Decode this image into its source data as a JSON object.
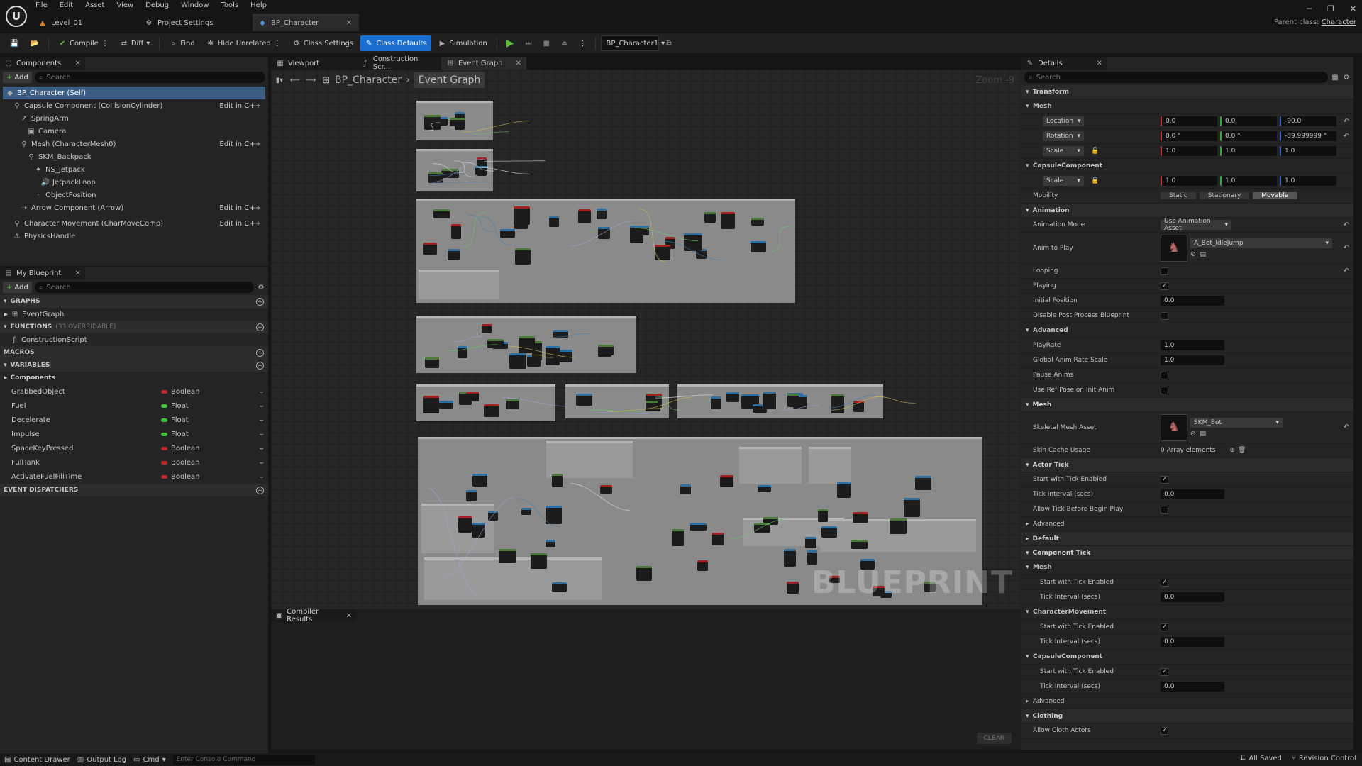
{
  "window": {
    "menu": [
      "File",
      "Edit",
      "Asset",
      "View",
      "Debug",
      "Window",
      "Tools",
      "Help"
    ],
    "tabs": [
      {
        "label": "Level_01",
        "icon": "level-icon"
      },
      {
        "label": "Project Settings",
        "icon": "gear-icon"
      },
      {
        "label": "BP_Character",
        "icon": "blueprint-icon",
        "active": true
      }
    ],
    "parent_class_label": "Parent class:",
    "parent_class_value": "Character"
  },
  "toolbar": {
    "compile": "Compile",
    "diff": "Diff",
    "find": "Find",
    "hide_unrelated": "Hide Unrelated",
    "class_settings": "Class Settings",
    "class_defaults": "Class Defaults",
    "simulation": "Simulation",
    "debug_object": "BP_Character1"
  },
  "components": {
    "title": "Components",
    "add": "Add",
    "search_placeholder": "Search",
    "tree": [
      {
        "label": "BP_Character (Self)",
        "indent": 0,
        "selected": true
      },
      {
        "label": "Capsule Component (CollisionCylinder)",
        "indent": 1,
        "edit": "Edit in C++"
      },
      {
        "label": "SpringArm",
        "indent": 2
      },
      {
        "label": "Camera",
        "indent": 3
      },
      {
        "label": "Mesh (CharacterMesh0)",
        "indent": 2,
        "edit": "Edit in C++"
      },
      {
        "label": "SKM_Backpack",
        "indent": 3
      },
      {
        "label": "NS_Jetpack",
        "indent": 4
      },
      {
        "label": "JetpackLoop",
        "indent": 5
      },
      {
        "label": "ObjectPosition",
        "indent": 4
      },
      {
        "label": "Arrow Component (Arrow)",
        "indent": 2,
        "edit": "Edit in C++"
      },
      {
        "label": "Character Movement (CharMoveComp)",
        "indent": 1,
        "edit": "Edit in C++"
      },
      {
        "label": "PhysicsHandle",
        "indent": 1
      }
    ]
  },
  "my_blueprint": {
    "title": "My Blueprint",
    "add": "Add",
    "search_placeholder": "Search",
    "graphs_header": "GRAPHS",
    "graphs": [
      "EventGraph"
    ],
    "functions_header": "FUNCTIONS",
    "functions_sub": "(33 OVERRIDABLE)",
    "functions": [
      "ConstructionScript"
    ],
    "macros_header": "MACROS",
    "variables_header": "VARIABLES",
    "variables_group": "Components",
    "variables": [
      {
        "name": "GrabbedObject",
        "type": "Boolean",
        "color": "#c0282a"
      },
      {
        "name": "Fuel",
        "type": "Float",
        "color": "#3fbf3f"
      },
      {
        "name": "Decelerate",
        "type": "Float",
        "color": "#3fbf3f"
      },
      {
        "name": "Impulse",
        "type": "Float",
        "color": "#3fbf3f"
      },
      {
        "name": "SpaceKeyPressed",
        "type": "Boolean",
        "color": "#c0282a"
      },
      {
        "name": "FullTank",
        "type": "Boolean",
        "color": "#c0282a"
      },
      {
        "name": "ActivateFuelFillTime",
        "type": "Boolean",
        "color": "#c0282a"
      }
    ],
    "dispatchers_header": "EVENT DISPATCHERS"
  },
  "graph": {
    "tabs": [
      "Viewport",
      "Construction Scr...",
      "Event Graph"
    ],
    "breadcrumb_root": "BP_Character",
    "breadcrumb_current": "Event Graph",
    "zoom": "Zoom -9",
    "watermark": "BLUEPRINT"
  },
  "compiler": {
    "title": "Compiler Results",
    "clear": "CLEAR"
  },
  "details": {
    "title": "Details",
    "search_placeholder": "Search",
    "transform": "Transform",
    "mesh": "Mesh",
    "location": "Location",
    "location_vals": [
      "0.0",
      "0.0",
      "-90.0"
    ],
    "rotation": "Rotation",
    "rotation_vals": [
      "0.0 °",
      "0.0 °",
      "-89.999999 °"
    ],
    "scale": "Scale",
    "scale_vals": [
      "1.0",
      "1.0",
      "1.0"
    ],
    "capsule": "CapsuleComponent",
    "capsule_scale_vals": [
      "1.0",
      "1.0",
      "1.0"
    ],
    "mobility": "Mobility",
    "mobility_opts": [
      "Static",
      "Stationary",
      "Movable"
    ],
    "animation": "Animation",
    "anim_mode": "Animation Mode",
    "anim_mode_val": "Use Animation Asset",
    "anim_to_play": "Anim to Play",
    "anim_asset": "A_Bot_IdleJump",
    "looping": "Looping",
    "playing": "Playing",
    "initial_position": "Initial Position",
    "initial_position_val": "0.0",
    "disable_pp": "Disable Post Process Blueprint",
    "advanced": "Advanced",
    "playrate": "PlayRate",
    "playrate_val": "1.0",
    "global_rate": "Global Anim Rate Scale",
    "global_rate_val": "1.0",
    "pause_anims": "Pause Anims",
    "use_ref_pose": "Use Ref Pose on Init Anim",
    "mesh_sec": "Mesh",
    "skeletal_mesh": "Skeletal Mesh Asset",
    "skeletal_mesh_val": "SKM_Bot",
    "skin_cache": "Skin Cache Usage",
    "skin_cache_val": "0 Array elements",
    "actor_tick": "Actor Tick",
    "start_tick": "Start with Tick Enabled",
    "tick_interval": "Tick Interval (secs)",
    "tick_interval_val": "0.0",
    "allow_tick": "Allow Tick Before Begin Play",
    "advanced2": "Advanced",
    "default": "Default",
    "component_tick": "Component Tick",
    "ct_mesh": "Mesh",
    "ct_start": "Start with Tick Enabled",
    "ct_interval": "Tick Interval (secs)",
    "ct_interval_val": "0.0",
    "ct_charmove": "CharacterMovement",
    "ct_start2": "Start with Tick Enabled",
    "ct_interval2": "Tick Interval (secs)",
    "ct_interval2_val": "0.0",
    "ct_capsule": "CapsuleComponent",
    "ct_start3": "Start with Tick Enabled",
    "ct_interval3": "Tick Interval (secs)",
    "ct_interval3_val": "0.0",
    "advanced3": "Advanced",
    "clothing": "Clothing",
    "allow_cloth": "Allow Cloth Actors"
  },
  "statusbar": {
    "content_drawer": "Content Drawer",
    "output_log": "Output Log",
    "cmd": "Cmd",
    "console_placeholder": "Enter Console Command",
    "all_saved": "All Saved",
    "revision_control": "Revision Control"
  }
}
